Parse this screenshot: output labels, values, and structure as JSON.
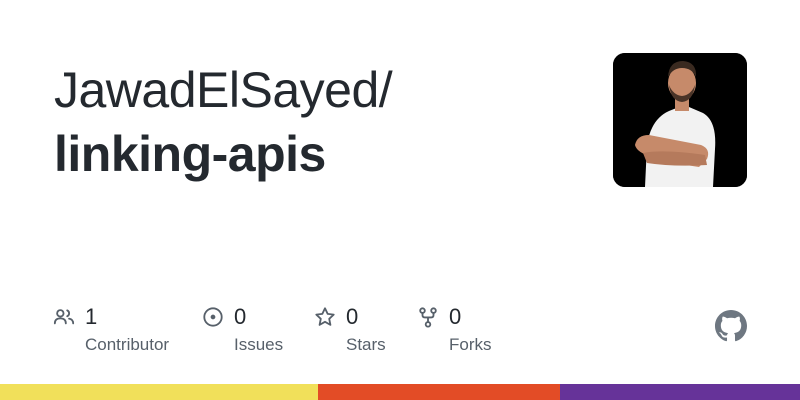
{
  "repo": {
    "owner": "JawadElSayed/",
    "name": "linking-apis"
  },
  "stats": {
    "contributors": {
      "count": "1",
      "label": "Contributor",
      "icon": "people-icon"
    },
    "issues": {
      "count": "0",
      "label": "Issues",
      "icon": "issue-opened-icon"
    },
    "stars": {
      "count": "0",
      "label": "Stars",
      "icon": "star-icon"
    },
    "forks": {
      "count": "0",
      "label": "Forks",
      "icon": "repo-forked-icon"
    }
  },
  "colors": {
    "text": "#24292f",
    "muted": "#57606a",
    "icon": "#57606a",
    "lang_yellow": "#f1e05a",
    "lang_orange": "#e34c26",
    "lang_purple": "#663399"
  },
  "language_bar": {
    "segments": [
      {
        "color": "#f1e05a",
        "share": 0.3975
      },
      {
        "color": "#e34c26",
        "share": 0.3025
      },
      {
        "color": "#663399",
        "share": 0.3
      }
    ]
  }
}
